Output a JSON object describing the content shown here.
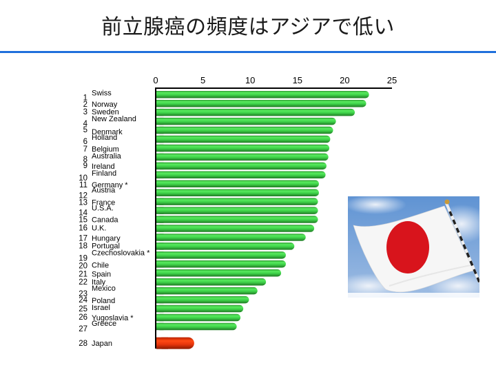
{
  "slide": {
    "title": "前立腺癌の頻度はアジアで低い"
  },
  "photo": {
    "subject": "japan-flag-photo",
    "colors": {
      "sky": "#6f9fd8",
      "cloud": "#e8eef6",
      "flag_white": "#f7f7f7",
      "disc": "#d8141c",
      "pole": "#e6e6e6"
    }
  },
  "colors": {
    "bar_default": "#3fd34a",
    "bar_highlight": "#e8360c",
    "title_rule": "#1f6fdc"
  },
  "chart_data": {
    "type": "bar",
    "orientation": "horizontal",
    "title": "",
    "xlabel": "",
    "ylabel": "",
    "xlim": [
      0,
      25
    ],
    "xticks": [
      0,
      5,
      10,
      15,
      20,
      25
    ],
    "x_axis_position": "top",
    "grid": false,
    "categories": [
      "Swiss",
      "Norway",
      "Sweden",
      "New Zealand",
      "Denmark",
      "Holland",
      "Belgium",
      "Australia",
      "Ireland",
      "Finland",
      "Germany *",
      "Austria",
      "France",
      "U.S.A.",
      "Canada",
      "U.K.",
      "Hungary",
      "Portugal",
      "Czechoslovakia *",
      "Chile",
      "Spain",
      "Italy",
      "Mexico",
      "Poland",
      "Israel",
      "Yugoslavia *",
      "Greece",
      "Japan"
    ],
    "ranks": [
      1,
      2,
      3,
      4,
      5,
      6,
      7,
      8,
      9,
      10,
      11,
      12,
      13,
      14,
      15,
      16,
      17,
      18,
      19,
      20,
      21,
      22,
      23,
      24,
      25,
      26,
      27,
      28
    ],
    "values": [
      22.5,
      22.2,
      21.0,
      19.0,
      18.7,
      18.4,
      18.3,
      18.2,
      18.0,
      17.9,
      17.2,
      17.2,
      17.1,
      17.1,
      17.1,
      16.7,
      15.8,
      14.6,
      13.7,
      13.7,
      13.2,
      11.6,
      10.7,
      9.8,
      9.2,
      8.9,
      8.5,
      4.0
    ],
    "highlight": [
      "Japan"
    ]
  }
}
